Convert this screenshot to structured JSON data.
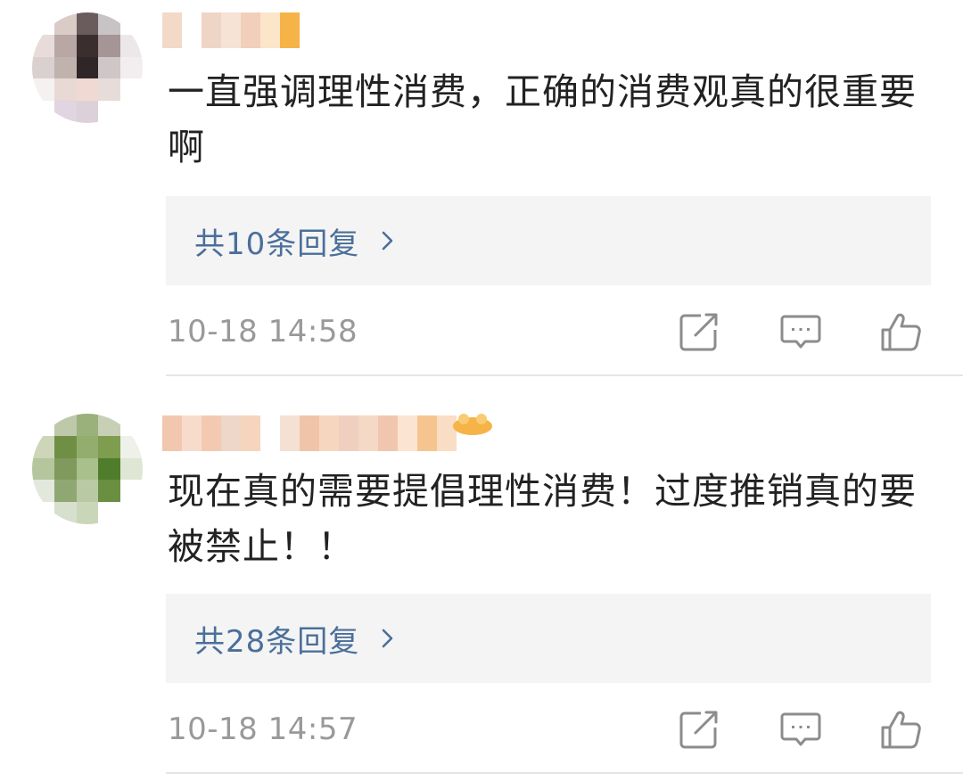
{
  "comments": [
    {
      "username_blur": [
        "#f3d9c8",
        "#ffffff",
        "#efd5c6",
        "#f6e3d6",
        "#f1cfbb",
        "#fbe6c9",
        "#f6b347",
        "#ffffff"
      ],
      "avatar_pixels": [
        "#ffffff",
        "#d9ccc6",
        "#6a5b5c",
        "#c8c3c5",
        "#ffffff",
        "#e7dcda",
        "#b8a7a4",
        "#3b2e2f",
        "#a59597",
        "#ece8ea",
        "#dad0cf",
        "#c0b3ae",
        "#2f2627",
        "#cfc6c7",
        "#f2eeef",
        "#f5f1f1",
        "#e9d9d5",
        "#f0d9d2",
        "#e6dcd9",
        "#ffffff",
        "#ffffff",
        "#e0d5e0",
        "#ddd1d9",
        "#ffffff",
        "#ffffff"
      ],
      "text": "一直强调理性消费，正确的消费观真的很重要啊",
      "replies_label": "共10条回复",
      "time": "10-18 14:58"
    },
    {
      "username_blur": [
        "#f2c7b0",
        "#f8dccb",
        "#f3c9b2",
        "#eed6c8",
        "#f6d4bd",
        "#ffffff",
        "#f5e0d4",
        "#f0c4a8",
        "#f7d6c0",
        "#efd0c0",
        "#f4d9c6",
        "#f1c6ae",
        "#fbe4d2",
        "#f6c58f",
        "#f9ddc5",
        "#ffffff"
      ],
      "avatar_pixels": [
        "#ffffff",
        "#bdc9a9",
        "#9ab17c",
        "#c7cfb5",
        "#ffffff",
        "#cdd6b8",
        "#6f8f44",
        "#93ad6f",
        "#7f9d4e",
        "#eef1e9",
        "#b5c59d",
        "#7f9a5c",
        "#a9bf8c",
        "#4f7d2c",
        "#dfe6d4",
        "#e3e8dc",
        "#8fa873",
        "#b9c9a4",
        "#6a8f41",
        "#ffffff",
        "#ffffff",
        "#d7dfcd",
        "#c9d6b8",
        "#ffffff",
        "#ffffff"
      ],
      "text": "现在真的需要提倡理性消费！过度推销真的要被禁止！！",
      "replies_label": "共28条回复",
      "time": "10-18 14:57"
    }
  ],
  "actions": {
    "edit_icon": "edit-share-icon",
    "reply_icon": "comment-icon",
    "like_icon": "thumbs-up-icon"
  },
  "colors": {
    "link": "#4a6f9a",
    "meta": "#999999",
    "text": "#222222",
    "reply_bg": "#f4f4f4",
    "badge": "#f6b347"
  }
}
